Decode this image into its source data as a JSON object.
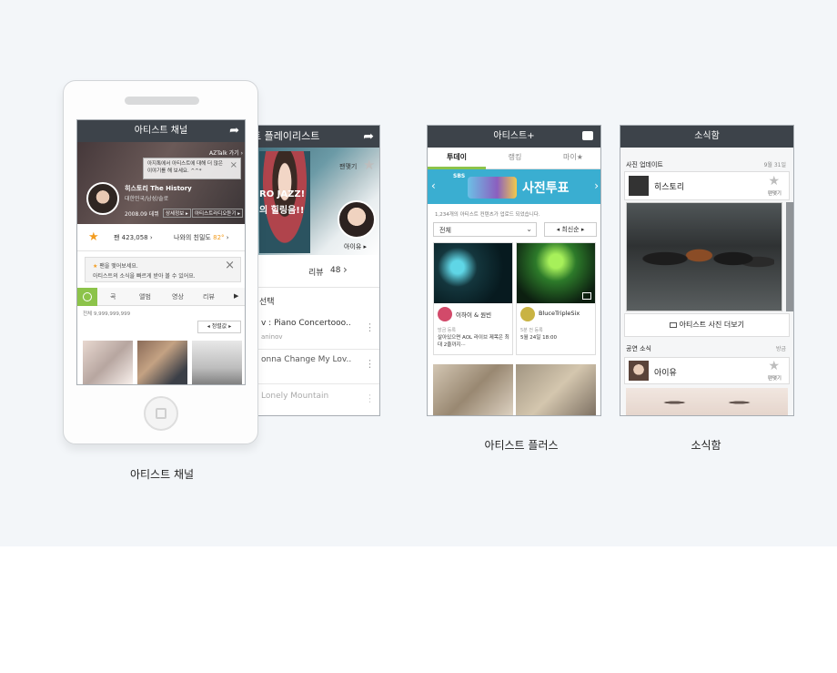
{
  "captions": {
    "channel": "아티스트 채널",
    "plus": "아티스트 플러스",
    "news": "소식함"
  },
  "playlist": {
    "title": "트 플레이리스트",
    "fav_label": "팬맺기",
    "banner_line1": "RO JAZZ!",
    "banner_line2": "의 힐링음!!",
    "avatar_label": "아이유 ▸",
    "review_label": "리뷰",
    "review_count": "48",
    "section_label": "선택",
    "songs": [
      {
        "title": "v : Piano Concertooo..",
        "artist": "aninov"
      },
      {
        "title": "onna Change My Lov..",
        "artist": ""
      },
      {
        "title": "Lonely Mountain",
        "artist": ""
      }
    ]
  },
  "channel": {
    "title": "아티스트 채널",
    "aztalk": "AZTalk 가기 ›",
    "tooltip": "아지톡에서 아티스트에 대해 더 많은 이야기를 해 보세요. ^^*",
    "artist_name": "히스토리 The History",
    "artist_info": "대한민국/남성/솔로",
    "debut": "2008.09 데뷔",
    "detail_btn": "상세정보 ▸",
    "radio_btn": "아티스트라디오듣기 ▸",
    "fans_label": "팬 423,058",
    "affinity_label": "나와의 친밀도",
    "affinity_value": "82°",
    "notice_line1": "팬을 맺어보세요.",
    "notice_line2": "아티스트의 소식을 빠르게 받아 볼 수 있어요.",
    "tabs": [
      "곡",
      "앨범",
      "영상",
      "리뷰"
    ],
    "total": "전체 9,999,999,999",
    "sort": "정렬값"
  },
  "plus": {
    "title": "아티스트+",
    "tabs": [
      "투데이",
      "랭킹",
      "마이★"
    ],
    "banner_brand": "SBS",
    "banner_title": "사전투표",
    "count_text": "1,234개의 아티스트 컨텐츠가 업로드 되었습니다.",
    "filter": "전체",
    "sort": "최신순",
    "cards": [
      {
        "artist": "이하이 & 원빈",
        "tag": "방금 등록",
        "desc": "살아있으면 AOL 라이브 제목은 최대 2줄까지···"
      },
      {
        "artist": "BluceTripleSix",
        "tag": "5분 전 등록",
        "desc": "5월 24일 18:00"
      }
    ]
  },
  "news": {
    "title": "소식함",
    "section1": "사진 업데이트",
    "date1": "9월 31일",
    "artist1": "히스토리",
    "fav_label": "팬맺기",
    "more_photos": "아티스트 사진 더보기",
    "section2": "공연 소식",
    "date2": "방금",
    "artist2": "아이유"
  }
}
